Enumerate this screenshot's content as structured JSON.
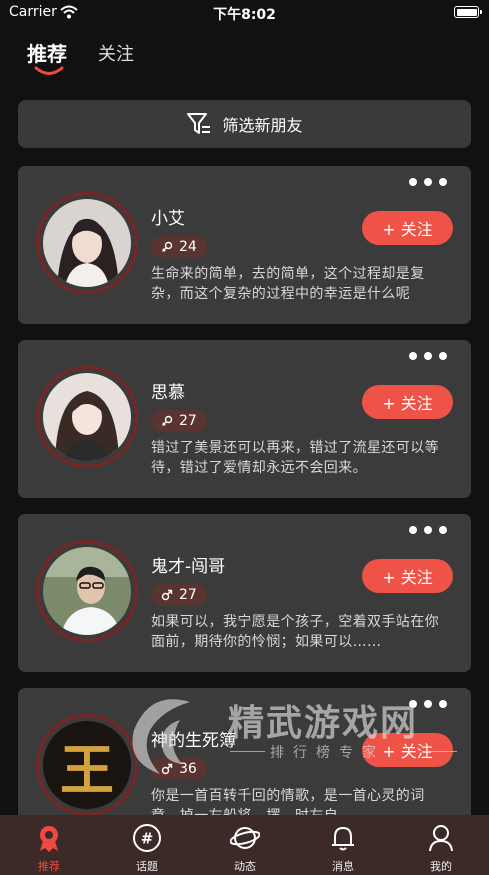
{
  "status": {
    "carrier": "Carrier",
    "time": "下午8:02"
  },
  "tabs": {
    "recommend": "推荐",
    "follow": "关注"
  },
  "filter": {
    "label": "筛选新朋友"
  },
  "follow_label": "+ 关注",
  "cards": [
    {
      "name": "小艾",
      "gender": "female",
      "age": "24",
      "bio": "生命来的简单，去的简单，这个过程却是复杂，而这个复杂的过程中的幸运是什么呢"
    },
    {
      "name": "思慕",
      "gender": "female",
      "age": "27",
      "bio": "错过了美景还可以再来，错过了流星还可以等待，错过了爱情却永远不会回来。"
    },
    {
      "name": "鬼才-闯哥",
      "gender": "male",
      "age": "27",
      "bio": "如果可以，我宁愿是个孩子，空着双手站在你面前，期待你的怜悯；如果可以……"
    },
    {
      "name": "神的生死簿",
      "gender": "male",
      "age": "36",
      "bio": "你是一首百转千回的情歌，是一首心灵的词章，掉一左船将，摆，时左自"
    }
  ],
  "avatar_glyph_card4": "王",
  "watermark": {
    "title": "精武游戏网",
    "subtitle": "排行榜专家"
  },
  "tabbar": [
    {
      "label": "推荐",
      "icon": "recommend-icon",
      "active": true
    },
    {
      "label": "话题",
      "icon": "hashtag-icon",
      "active": false
    },
    {
      "label": "动态",
      "icon": "planet-icon",
      "active": false
    },
    {
      "label": "消息",
      "icon": "bell-icon",
      "active": false
    },
    {
      "label": "我的",
      "icon": "profile-icon",
      "active": false
    }
  ],
  "colors": {
    "accent": "#ef5347",
    "card": "#3b3b3b",
    "background": "#111111",
    "tabbar": "#3c2a28"
  }
}
